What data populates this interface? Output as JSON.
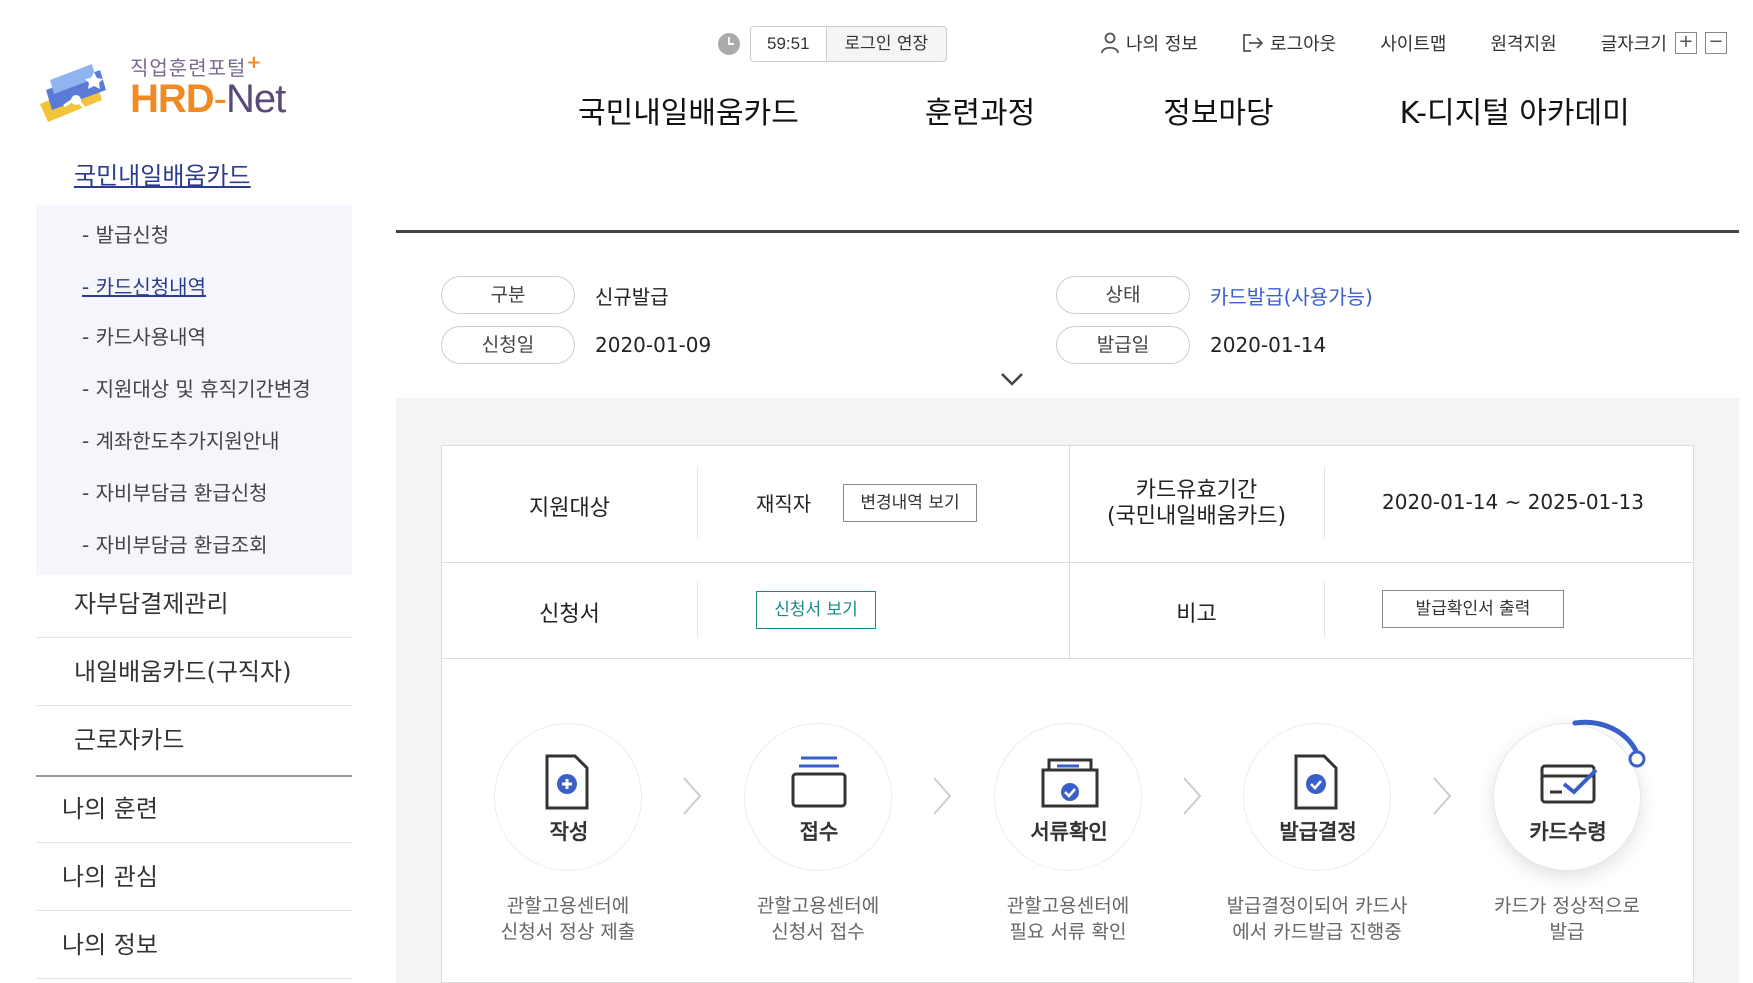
{
  "logo": {
    "sub": "직업훈련포털",
    "plus": "+",
    "hrd": "HRD",
    "dash": "-",
    "net": "Net"
  },
  "timer": {
    "value": "59:51",
    "extend_label": "로그인 연장"
  },
  "util": {
    "myinfo": "나의 정보",
    "logout": "로그아웃",
    "sitemap": "사이트맵",
    "remote": "원격지원",
    "fontsize": "글자크기",
    "plus": "+",
    "minus": "−"
  },
  "gnb": [
    "국민내일배움카드",
    "훈련과정",
    "정보마당",
    "K-디지털 아카데미"
  ],
  "lnb": {
    "title": "국민내일배움카드",
    "sub": [
      "- 발급신청",
      "- 카드신청내역",
      "- 카드사용내역",
      "- 지원대상 및 휴직기간변경",
      "- 계좌한도추가지원안내",
      "- 자비부담금 환급신청",
      "- 자비부담금 환급조회"
    ],
    "items2": [
      "자부담결제관리",
      "내일배움카드(구직자)",
      "근로자카드"
    ],
    "items1": [
      "나의 훈련",
      "나의 관심",
      "나의 정보"
    ]
  },
  "info": {
    "type_label": "구분",
    "type_value": "신규발급",
    "status_label": "상태",
    "status_value": "카드발급(사용가능)",
    "apply_label": "신청일",
    "apply_value": "2020-01-09",
    "issue_label": "발급일",
    "issue_value": "2020-01-14"
  },
  "table": {
    "target_label": "지원대상",
    "target_value": "재직자",
    "history_btn": "변경내역 보기",
    "valid_label_1": "카드유효기간",
    "valid_label_2": "(국민내일배움카드)",
    "valid_value": "2020-01-14 ~ 2025-01-13",
    "form_label": "신청서",
    "form_btn": "신청서 보기",
    "note_label": "비고",
    "cert_btn": "발급확인서 출력"
  },
  "steps": [
    {
      "label": "작성",
      "desc": "관할고용센터에\n신청서 정상 제출"
    },
    {
      "label": "접수",
      "desc": "관할고용센터에\n신청서 접수"
    },
    {
      "label": "서류확인",
      "desc": "관할고용센터에\n필요 서류 확인"
    },
    {
      "label": "발급결정",
      "desc": "발급결정이되어 카드사\n에서 카드발급 진행중"
    },
    {
      "label": "카드수령",
      "desc": "카드가 정상적으로\n발급"
    }
  ],
  "colors": {
    "accent_blue": "#2b3d8c",
    "status_blue": "#3a5fc8",
    "teal": "#1a8a82",
    "step_icon": "#3a5fc8",
    "orange": "#f08a24"
  }
}
